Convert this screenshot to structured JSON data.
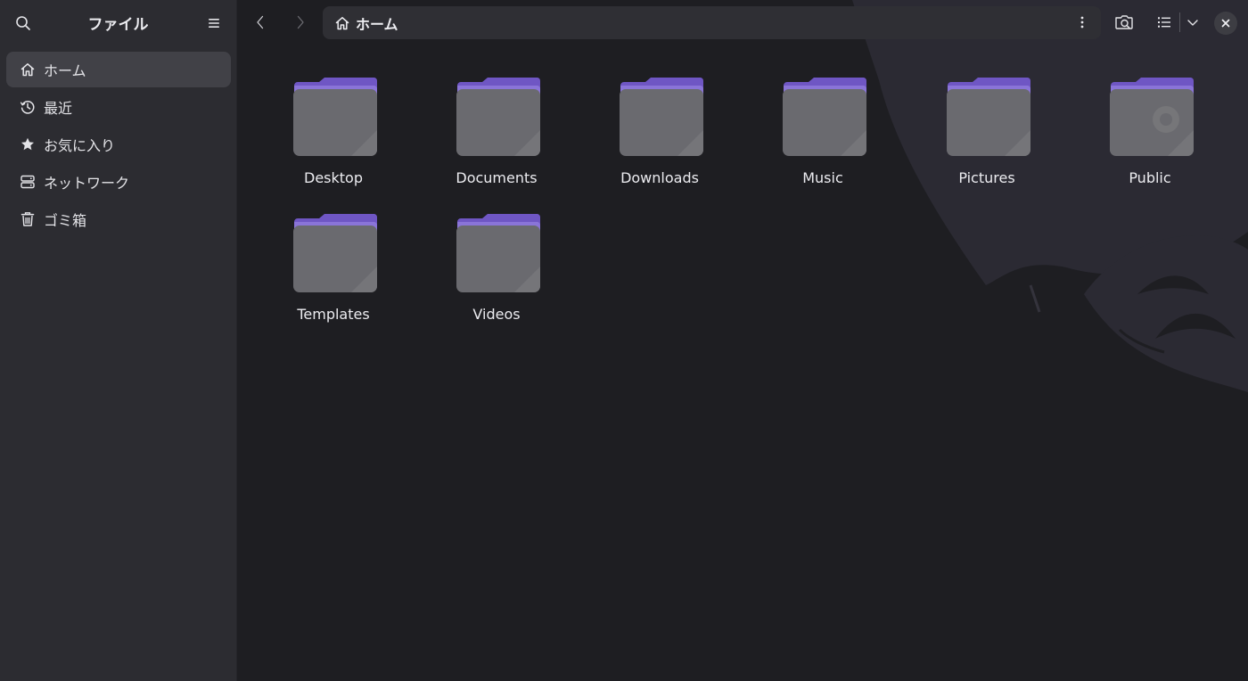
{
  "sidebar": {
    "title": "ファイル",
    "items": [
      {
        "label": "ホーム",
        "icon": "home-icon",
        "active": true
      },
      {
        "label": "最近",
        "icon": "clock-icon"
      },
      {
        "label": "お気に入り",
        "icon": "star-icon"
      },
      {
        "label": "ネットワーク",
        "icon": "network-icon"
      },
      {
        "label": "ゴミ箱",
        "icon": "trash-icon"
      }
    ]
  },
  "toolbar": {
    "path_label": "ホーム",
    "path_icon": "home-icon"
  },
  "folders": [
    {
      "name": "Desktop"
    },
    {
      "name": "Documents"
    },
    {
      "name": "Downloads"
    },
    {
      "name": "Music"
    },
    {
      "name": "Pictures"
    },
    {
      "name": "Public"
    },
    {
      "name": "Templates"
    },
    {
      "name": "Videos"
    }
  ],
  "colors": {
    "sidebar_bg": "#2c2c31",
    "main_bg": "#1e1e22",
    "folder_tab": "#7a62cc",
    "folder_body": "#6b6b70",
    "accent": "#7b5fd4"
  }
}
